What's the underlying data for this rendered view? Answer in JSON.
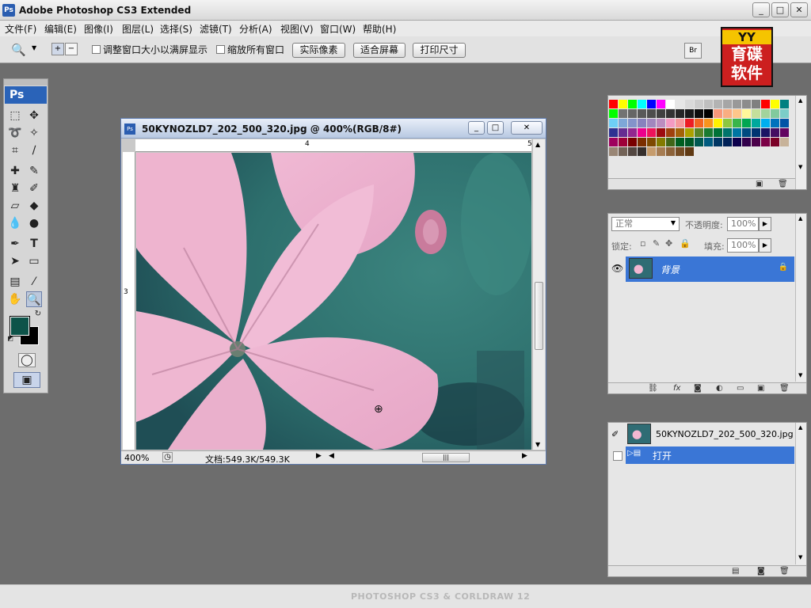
{
  "window": {
    "title": "Adobe Photoshop CS3 Extended",
    "app_icon": "Ps",
    "min": "_",
    "max": "□",
    "close": "✕"
  },
  "menu": [
    "文件(F)",
    "编辑(E)",
    "图像(I)",
    "图层(L)",
    "选择(S)",
    "滤镜(T)",
    "分析(A)",
    "视图(V)",
    "窗口(W)",
    "帮助(H)"
  ],
  "options": {
    "resize_label": "调整窗口大小以满屏显示",
    "zoom_all_label": "缩放所有窗口",
    "actual_pixels": "实际像素",
    "fit_screen": "适合屏幕",
    "print_size": "打印尺寸"
  },
  "watermark": {
    "top": "YY",
    "line1": "育碟",
    "line2": "软件"
  },
  "toolbox": {
    "logo": "Ps"
  },
  "document": {
    "title": "50KYNOZLD7_202_500_320.jpg @ 400%(RGB/8#)",
    "ruler_h": [
      "4",
      "5"
    ],
    "ruler_v": [
      "3"
    ],
    "zoom": "400%",
    "doc_info": "文档:549.3K/549.3K"
  },
  "layers": {
    "blend_mode": "正常",
    "opacity_label": "不透明度:",
    "opacity_value": "100%",
    "lock_label": "锁定:",
    "fill_label": "填充:",
    "fill_value": "100%",
    "layer_name": "背景"
  },
  "history": {
    "snapshot_name": "50KYNOZLD7_202_500_320.jpg",
    "step": "打开"
  },
  "footer": {
    "brand": "PHOTOSHOP CS3 & CORLDRAW 12"
  },
  "colors": {
    "foreground": "#0d5349",
    "background": "#000000",
    "selection": "#3a76d6"
  },
  "swatches": [
    "#ff0000",
    "#ffff00",
    "#00ff00",
    "#00ffff",
    "#0000ff",
    "#ff00ff",
    "#ffffff",
    "#e6e6e6",
    "#d9d9d9",
    "#cccccc",
    "#bfbfbf",
    "#b3b3b3",
    "#a6a6a6",
    "#999999",
    "#8c8c8c",
    "#808080",
    "#ff0000",
    "#ffff00",
    "#008080",
    "#00ff00",
    "#737373",
    "#666666",
    "#595959",
    "#4d4d4d",
    "#404040",
    "#333333",
    "#262626",
    "#1a1a1a",
    "#0d0d0d",
    "#000000",
    "#f7977a",
    "#f9ad81",
    "#fdc68a",
    "#fff79a",
    "#c4df9b",
    "#a2d39c",
    "#82ca9d",
    "#7bcdc8",
    "#6ecff6",
    "#7ea7d8",
    "#8493ca",
    "#8882be",
    "#a187be",
    "#bc8dbf",
    "#f49ac2",
    "#f6989d",
    "#ed1c24",
    "#f26522",
    "#f7941d",
    "#fff200",
    "#8dc73f",
    "#39b54a",
    "#00a651",
    "#00a99d",
    "#00aeef",
    "#0072bc",
    "#0054a6",
    "#2e3192",
    "#662d91",
    "#92278f",
    "#ec008c",
    "#ed145b",
    "#9e0b0f",
    "#a0410d",
    "#a36209",
    "#aba000",
    "#598527",
    "#1a7b30",
    "#007236",
    "#00746b",
    "#0076a3",
    "#004b80",
    "#003471",
    "#1b1464",
    "#440e62",
    "#630460",
    "#9e005d",
    "#9e0039",
    "#790000",
    "#7b2e00",
    "#7d4900",
    "#827b00",
    "#406618",
    "#005e20",
    "#005826",
    "#005952",
    "#005b7f",
    "#003663",
    "#002157",
    "#0d004c",
    "#32004b",
    "#4b0049",
    "#7b0046",
    "#7a0026",
    "#c7b299",
    "#998675",
    "#736357",
    "#534741",
    "#362f2d",
    "#c69c6d",
    "#a67c52",
    "#8c6239",
    "#754c24",
    "#603913"
  ]
}
